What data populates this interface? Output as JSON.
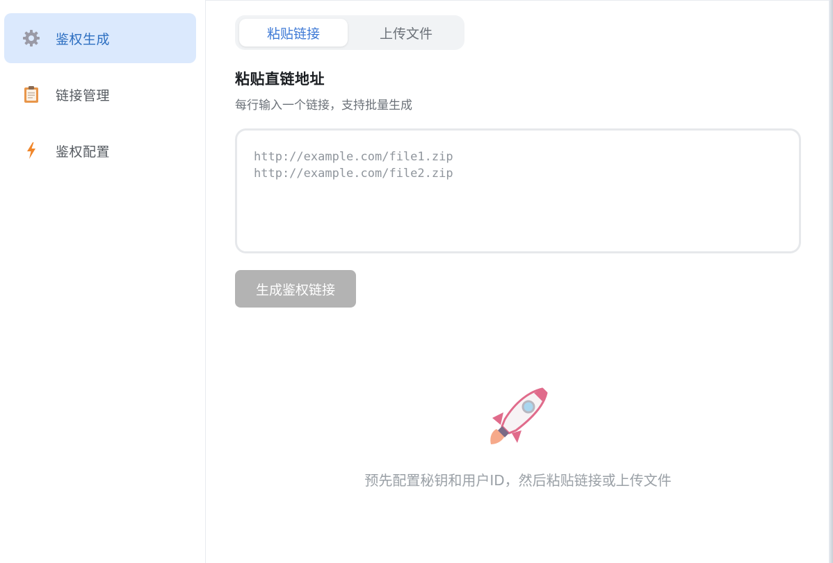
{
  "sidebar": {
    "items": [
      {
        "label": "鉴权生成",
        "icon": "gear-icon",
        "active": true
      },
      {
        "label": "链接管理",
        "icon": "clipboard-icon",
        "active": false
      },
      {
        "label": "鉴权配置",
        "icon": "lightning-icon",
        "active": false
      }
    ]
  },
  "tabs": [
    {
      "label": "粘贴链接",
      "active": true
    },
    {
      "label": "上传文件",
      "active": false
    }
  ],
  "form": {
    "title": "粘贴直链地址",
    "subtitle": "每行输入一个链接，支持批量生成",
    "placeholder": "http://example.com/file1.zip\nhttp://example.com/file2.zip",
    "button_label": "生成鉴权链接"
  },
  "empty_state": {
    "icon": "rocket-icon",
    "text": "预先配置秘钥和用户ID，然后粘贴链接或上传文件"
  },
  "colors": {
    "accent": "#3f7ad6",
    "active_nav_bg": "#dbe9fd",
    "button_disabled": "#b3b3b3"
  }
}
